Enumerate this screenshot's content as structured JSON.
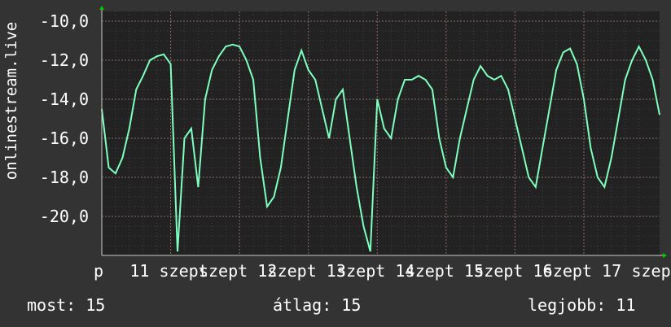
{
  "chart_data": {
    "type": "line",
    "title": "",
    "xlabel": "",
    "ylabel": "onlinestream.live",
    "ylim": [
      -22.0,
      -9.5
    ],
    "y_ticks": [
      "-10,0",
      "-12,0",
      "-14,0",
      "-16,0",
      "-18,0",
      "-20,0"
    ],
    "y_tick_values": [
      -10,
      -12,
      -14,
      -16,
      -18,
      -20
    ],
    "x_tick_labels": [
      "p",
      "11 szept",
      "szept 12",
      "szept 13",
      "szept 14",
      "szept 15",
      "szept 16",
      "szept 17",
      "szep"
    ],
    "x_tick_days": [
      10.0,
      11,
      12,
      13,
      14,
      15,
      16,
      17,
      18
    ],
    "grid": true,
    "colors": {
      "background": "#333333",
      "plot_background": "#222222",
      "grid": "#555555",
      "line": "#7fffbf",
      "arrow": "#00cc00",
      "text": "#ffffff"
    },
    "series": [
      {
        "name": "",
        "x": [
          10.0,
          10.1,
          10.2,
          10.3,
          10.4,
          10.5,
          10.6,
          10.7,
          10.8,
          10.9,
          11.0,
          11.1,
          11.2,
          11.3,
          11.4,
          11.5,
          11.6,
          11.7,
          11.8,
          11.9,
          12.0,
          12.1,
          12.2,
          12.3,
          12.4,
          12.5,
          12.6,
          12.7,
          12.8,
          12.9,
          13.0,
          13.1,
          13.2,
          13.3,
          13.4,
          13.5,
          13.6,
          13.7,
          13.8,
          13.9,
          14.0,
          14.1,
          14.2,
          14.3,
          14.4,
          14.5,
          14.6,
          14.7,
          14.8,
          14.9,
          15.0,
          15.1,
          15.2,
          15.3,
          15.4,
          15.5,
          15.6,
          15.7,
          15.8,
          15.9,
          16.0,
          16.1,
          16.2,
          16.3,
          16.4,
          16.5,
          16.6,
          16.7,
          16.8,
          16.9,
          17.0,
          17.1,
          17.2,
          17.3,
          17.4,
          17.5,
          17.6,
          17.7,
          17.8,
          17.9,
          18.0,
          18.1
        ],
        "values": [
          -14.5,
          -17.5,
          -17.8,
          -17.0,
          -15.5,
          -13.5,
          -12.8,
          -12.0,
          -11.8,
          -11.7,
          -12.2,
          -21.8,
          -16.0,
          -15.5,
          -18.5,
          -14.0,
          -12.5,
          -11.8,
          -11.3,
          -11.2,
          -11.3,
          -12.0,
          -13.0,
          -17.0,
          -19.5,
          -19.0,
          -17.5,
          -15.0,
          -12.5,
          -11.5,
          -12.5,
          -13.0,
          -14.5,
          -16.0,
          -14.0,
          -13.5,
          -16.0,
          -18.5,
          -20.5,
          -21.8,
          -14.0,
          -15.5,
          -16.0,
          -14.0,
          -13.0,
          -13.0,
          -12.8,
          -13.0,
          -13.5,
          -16.0,
          -17.5,
          -18.0,
          -16.0,
          -14.5,
          -13.0,
          -12.3,
          -12.8,
          -13.0,
          -12.8,
          -13.5,
          -15.0,
          -16.5,
          -18.0,
          -18.5,
          -16.5,
          -14.5,
          -12.5,
          -11.6,
          -11.4,
          -12.2,
          -14.0,
          -16.5,
          -18.0,
          -18.5,
          -17.0,
          -15.0,
          -13.0,
          -12.0,
          -11.3,
          -12.0,
          -13.0,
          -14.8
        ]
      }
    ]
  },
  "stats": {
    "now": "most: 15",
    "avg": "átlag: 15",
    "best": "legjobb: 11"
  }
}
